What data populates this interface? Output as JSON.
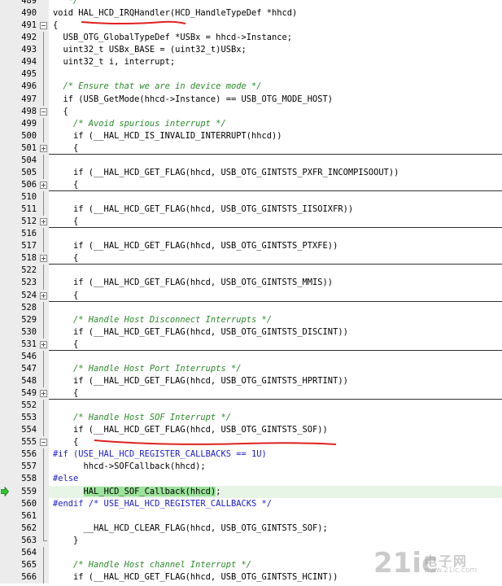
{
  "editor": {
    "lines": [
      {
        "num": "489",
        "code": "   */",
        "cls": "cm"
      },
      {
        "num": "490",
        "code": "void HAL_HCD_IRQHandler(HCD_HandleTypeDef *hhcd)"
      },
      {
        "num": "491",
        "code": "{",
        "fold": "minus"
      },
      {
        "num": "492",
        "code": "  USB_OTG_GlobalTypeDef *USBx = hhcd->Instance;"
      },
      {
        "num": "493",
        "code": "  uint32_t USBx_BASE = (uint32_t)USBx;"
      },
      {
        "num": "494",
        "code": "  uint32_t i, interrupt;"
      },
      {
        "num": "495",
        "code": ""
      },
      {
        "num": "496",
        "code": "  /* Ensure that we are in device mode */",
        "cls": "cm"
      },
      {
        "num": "497",
        "code": "  if (USB_GetMode(hhcd->Instance) == USB_OTG_MODE_HOST)"
      },
      {
        "num": "498",
        "code": "  {",
        "fold": "minus"
      },
      {
        "num": "499",
        "code": "    /* Avoid spurious interrupt */",
        "cls": "cm"
      },
      {
        "num": "500",
        "code": "    if (__HAL_HCD_IS_INVALID_INTERRUPT(hhcd))"
      },
      {
        "num": "501",
        "code": "    {",
        "fold": "plus",
        "divider": true
      },
      {
        "num": "504",
        "code": ""
      },
      {
        "num": "505",
        "code": "    if (__HAL_HCD_GET_FLAG(hhcd, USB_OTG_GINTSTS_PXFR_INCOMPISOOUT))"
      },
      {
        "num": "506",
        "code": "    {",
        "fold": "plus",
        "divider": true
      },
      {
        "num": "510",
        "code": ""
      },
      {
        "num": "511",
        "code": "    if (__HAL_HCD_GET_FLAG(hhcd, USB_OTG_GINTSTS_IISOIXFR))"
      },
      {
        "num": "512",
        "code": "    {",
        "fold": "plus",
        "divider": true
      },
      {
        "num": "516",
        "code": ""
      },
      {
        "num": "517",
        "code": "    if (__HAL_HCD_GET_FLAG(hhcd, USB_OTG_GINTSTS_PTXFE))"
      },
      {
        "num": "518",
        "code": "    {",
        "fold": "plus",
        "divider": true
      },
      {
        "num": "522",
        "code": ""
      },
      {
        "num": "523",
        "code": "    if (__HAL_HCD_GET_FLAG(hhcd, USB_OTG_GINTSTS_MMIS))"
      },
      {
        "num": "524",
        "code": "    {",
        "fold": "plus",
        "divider": true
      },
      {
        "num": "528",
        "code": ""
      },
      {
        "num": "529",
        "code": "    /* Handle Host Disconnect Interrupts */",
        "cls": "cm"
      },
      {
        "num": "530",
        "code": "    if (__HAL_HCD_GET_FLAG(hhcd, USB_OTG_GINTSTS_DISCINT))"
      },
      {
        "num": "531",
        "code": "    {",
        "fold": "plus",
        "divider": true
      },
      {
        "num": "546",
        "code": ""
      },
      {
        "num": "547",
        "code": "    /* Handle Host Port Interrupts */",
        "cls": "cm"
      },
      {
        "num": "548",
        "code": "    if (__HAL_HCD_GET_FLAG(hhcd, USB_OTG_GINTSTS_HPRTINT))"
      },
      {
        "num": "549",
        "code": "    {",
        "fold": "plus",
        "divider": true
      },
      {
        "num": "552",
        "code": ""
      },
      {
        "num": "553",
        "code": "    /* Handle Host SOF Interrupt */",
        "cls": "cm"
      },
      {
        "num": "554",
        "code": "    if (__HAL_HCD_GET_FLAG(hhcd, USB_OTG_GINTSTS_SOF))"
      },
      {
        "num": "555",
        "code": "    {",
        "fold": "minus"
      },
      {
        "num": "556",
        "code": "#if (USE_HAL_HCD_REGISTER_CALLBACKS == 1U)",
        "cls": "pp"
      },
      {
        "num": "557",
        "code": "      hhcd->SOFCallback(hhcd);"
      },
      {
        "num": "558",
        "code": "#else",
        "cls": "pp"
      },
      {
        "num": "559",
        "code": "      HAL_HCD_SOF_Callback(hhcd);",
        "active": true
      },
      {
        "num": "560",
        "code": "#endif /* USE_HAL_HCD_REGISTER_CALLBACKS */",
        "cls": "pp"
      },
      {
        "num": "561",
        "code": ""
      },
      {
        "num": "562",
        "code": "      __HAL_HCD_CLEAR_FLAG(hhcd, USB_OTG_GINTSTS_SOF);"
      },
      {
        "num": "563",
        "code": "    }",
        "end": true
      },
      {
        "num": "564",
        "code": ""
      },
      {
        "num": "565",
        "code": "    /* Handle Host channel Interrupt */",
        "cls": "cm"
      },
      {
        "num": "566",
        "code": "    if (__HAL_HCD_GET_FLAG(hhcd, USB_OTG_GINTSTS_HCINT))"
      }
    ]
  },
  "watermark": {
    "main": "21ic",
    "cn": "电子网",
    "url": "www.21ic.com"
  },
  "colors": {
    "comment": "#2a8a2a",
    "preprocessor": "#1a1ad0",
    "highlight": "#9ce39c",
    "annotation": "#e02020",
    "arrow": "#2ec52e"
  }
}
